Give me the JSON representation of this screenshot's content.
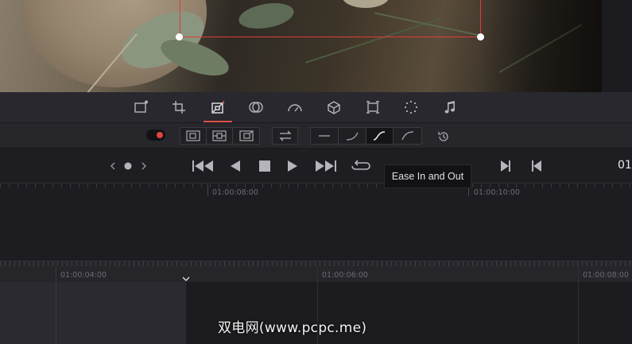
{
  "viewer": {
    "image_description_icon": "photo-herbs-on-plate",
    "crop_box_color": "#e23a3a"
  },
  "inspector_tabs": {
    "items": [
      {
        "name": "transform",
        "icon": "transform-icon",
        "active": false
      },
      {
        "name": "crop",
        "icon": "crop-icon",
        "active": false
      },
      {
        "name": "dynamic-zoom",
        "icon": "dynamic-zoom-icon",
        "active": true
      },
      {
        "name": "composite",
        "icon": "composite-icon",
        "active": false
      },
      {
        "name": "speed",
        "icon": "speedometer-icon",
        "active": false
      },
      {
        "name": "stabilization",
        "icon": "stabilization-icon",
        "active": false
      },
      {
        "name": "lens-correction",
        "icon": "lens-correction-icon",
        "active": false
      },
      {
        "name": "retime",
        "icon": "retime-icon",
        "active": false
      },
      {
        "name": "audio",
        "icon": "music-note-icon",
        "active": false
      }
    ],
    "accent_color": "#e2504a"
  },
  "keyframe_options": {
    "ease_options": [
      "linear",
      "ease-in",
      "ease-in-and-out",
      "ease-out"
    ],
    "selected_ease": "ease-in-and-out"
  },
  "transport": {
    "timecode": "01"
  },
  "tooltip": {
    "text": "Ease In and Out"
  },
  "timeline_upper": {
    "labels": [
      "01:00:08:00",
      "01:00:10:00"
    ]
  },
  "timeline_lower": {
    "labels": [
      "01:00:04:00",
      "01:00:06:00",
      "01:00:08:00"
    ]
  },
  "watermark": {
    "text": "双电网(www.pcpc.me)"
  }
}
